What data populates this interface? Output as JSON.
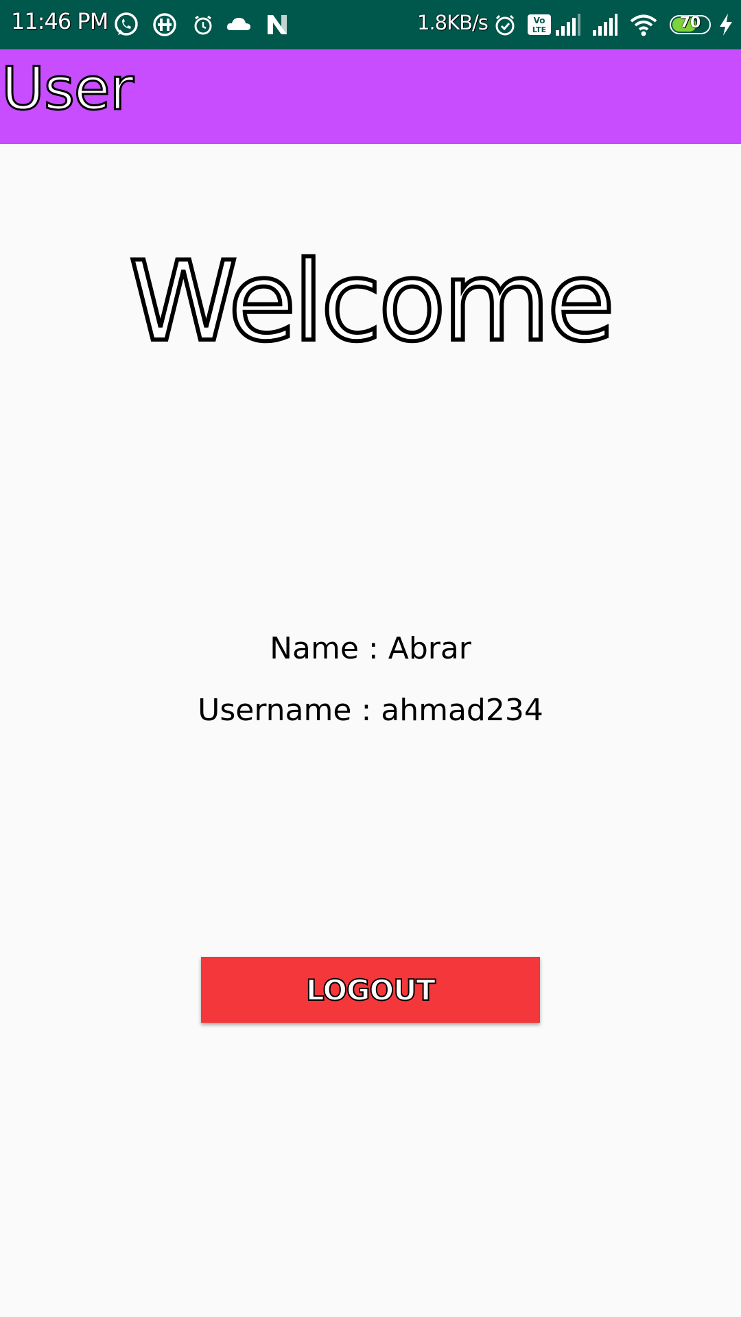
{
  "status_bar": {
    "time": "11:46 PM",
    "network_speed": "1.8KB/s",
    "battery_percent": 70,
    "battery_label": "70",
    "charging": true,
    "volte_label_top": "Vo",
    "volte_label_bottom": "LTE",
    "left_icons": [
      "whatsapp-icon",
      "hike-icon",
      "alarm-icon",
      "cloud-icon",
      "n-app-icon"
    ],
    "right_icons": [
      "alarm-icon",
      "volte-icon",
      "signal-icon",
      "signal-icon",
      "wifi-icon",
      "battery-icon",
      "charging-icon"
    ],
    "background_color": "#00574b"
  },
  "app_bar": {
    "title": "User",
    "background_color": "#c84dff"
  },
  "main": {
    "welcome_text": "Welcome",
    "name_line": "Name : Abrar",
    "username_line": "Username : ahmad234"
  },
  "logout": {
    "label": "LOGOUT",
    "background_color": "#f3373a"
  }
}
